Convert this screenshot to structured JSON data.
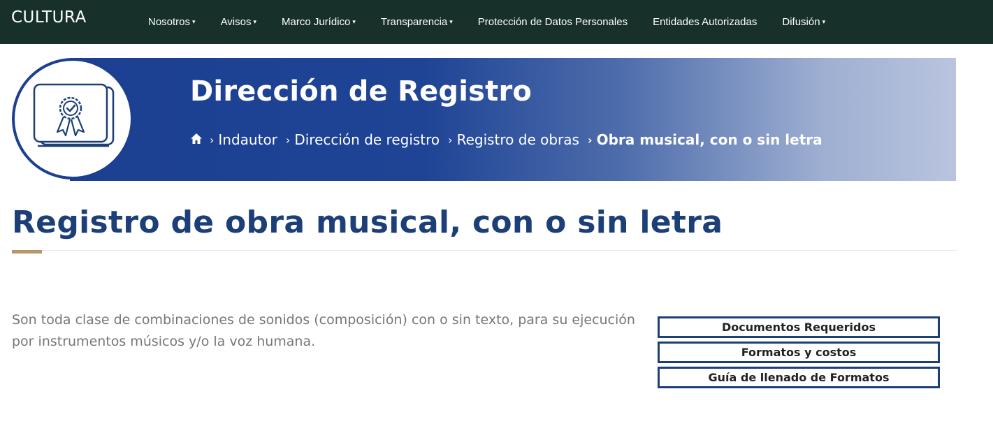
{
  "nav": {
    "brand": "CULTURA",
    "items": [
      {
        "label": "Nosotros",
        "dropdown": true
      },
      {
        "label": "Avisos",
        "dropdown": true
      },
      {
        "label": "Marco Jurídico",
        "dropdown": true
      },
      {
        "label": "Transparencia",
        "dropdown": true
      },
      {
        "label": "Protección de Datos Personales",
        "dropdown": false
      },
      {
        "label": "Entidades Autorizadas",
        "dropdown": false
      },
      {
        "label": "Difusión",
        "dropdown": true
      }
    ],
    "caret": "▾"
  },
  "banner": {
    "title": "Dirección de Registro",
    "icon": "certificate-icon",
    "breadcrumb": [
      {
        "label": "Indautor"
      },
      {
        "label": "Dirección de registro"
      },
      {
        "label": "Registro de obras"
      },
      {
        "label": "Obra musical, con o sin letra"
      }
    ],
    "separator": "›"
  },
  "page": {
    "title": "Registro de obra musical, con o sin letra",
    "description": "Son toda clase de combinaciones de sonidos (composición) con o sin texto, para su ejecución por instrumentos músicos y/o la voz humana."
  },
  "side_buttons": [
    {
      "label": "Documentos Requeridos"
    },
    {
      "label": "Formatos y costos"
    },
    {
      "label": "Guía de llenado de Formatos"
    }
  ],
  "colors": {
    "nav_bg": "#17302a",
    "banner_blue": "#1c3f91",
    "title_blue": "#1c3f77",
    "accent_gold": "#b9956a"
  }
}
